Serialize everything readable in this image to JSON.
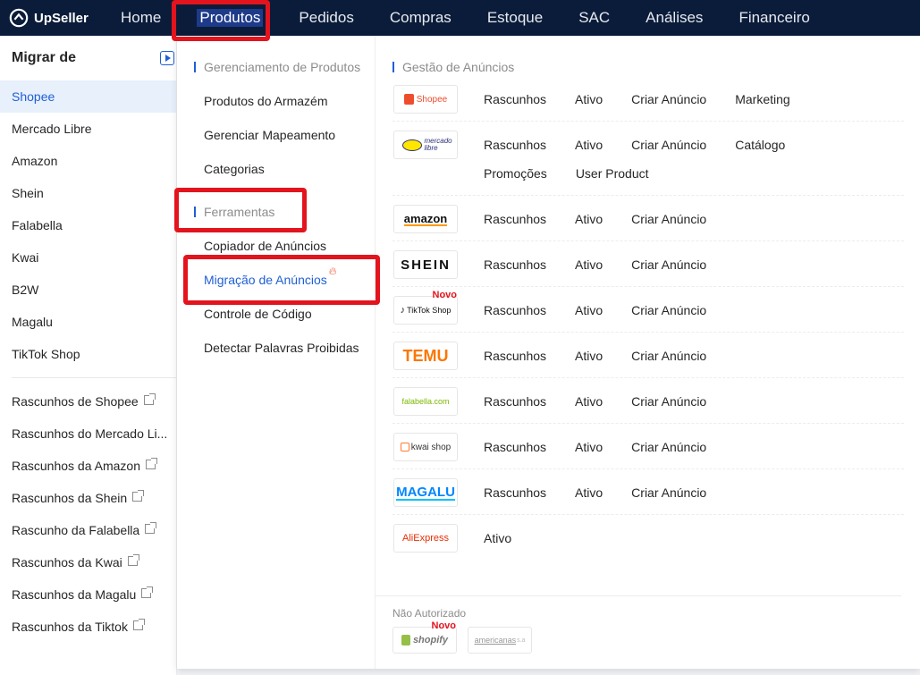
{
  "nav": {
    "brand": "UpSeller",
    "items": [
      "Home",
      "Produtos",
      "Pedidos",
      "Compras",
      "Estoque",
      "SAC",
      "Análises",
      "Financeiro"
    ]
  },
  "sidebar": {
    "title": "Migrar de",
    "platforms": [
      "Shopee",
      "Mercado Libre",
      "Amazon",
      "Shein",
      "Falabella",
      "Kwai",
      "B2W",
      "Magalu",
      "TikTok Shop"
    ],
    "drafts": [
      "Rascunhos de Shopee",
      "Rascunhos do Mercado Li...",
      "Rascunhos da Amazon",
      "Rascunhos da Shein",
      "Rascunho da Falabella",
      "Rascunhos da Kwai",
      "Rascunhos da Magalu",
      "Rascunhos da Tiktok"
    ]
  },
  "menu": {
    "section1": "Gerenciamento de Produtos",
    "section1_items": [
      "Produtos do Armazém",
      "Gerenciar Mapeamento",
      "Categorias"
    ],
    "section2": "Ferramentas",
    "section2_items": [
      "Copiador de Anúncios",
      "Migração de Anúncios",
      "Controle de Código",
      "Detectar Palavras Proibidas"
    ]
  },
  "listings": {
    "title": "Gestão de Anúncios",
    "rows": [
      {
        "logo": "Shopee",
        "links": [
          "Rascunhos",
          "Ativo",
          "Criar Anúncio",
          "Marketing"
        ]
      },
      {
        "logo": "mercado libre",
        "links": [
          "Rascunhos",
          "Ativo",
          "Criar Anúncio",
          "Catálogo",
          "Promoções",
          "User Product"
        ]
      },
      {
        "logo": "amazon",
        "links": [
          "Rascunhos",
          "Ativo",
          "Criar Anúncio"
        ]
      },
      {
        "logo": "SHEIN",
        "links": [
          "Rascunhos",
          "Ativo",
          "Criar Anúncio"
        ]
      },
      {
        "logo": "TikTok Shop",
        "badge": "Novo",
        "links": [
          "Rascunhos",
          "Ativo",
          "Criar Anúncio"
        ]
      },
      {
        "logo": "TEMU",
        "links": [
          "Rascunhos",
          "Ativo",
          "Criar Anúncio"
        ]
      },
      {
        "logo": "falabella.com",
        "links": [
          "Rascunhos",
          "Ativo",
          "Criar Anúncio"
        ]
      },
      {
        "logo": "kwai shop",
        "links": [
          "Rascunhos",
          "Ativo",
          "Criar Anúncio"
        ]
      },
      {
        "logo": "MAGALU",
        "links": [
          "Rascunhos",
          "Ativo",
          "Criar Anúncio"
        ]
      },
      {
        "logo": "AliExpress",
        "links": [
          "Ativo"
        ]
      }
    ],
    "unauthorized_label": "Não Autorizado",
    "unauthorized": [
      {
        "logo": "shopify",
        "badge": "Novo"
      },
      {
        "logo": "americanas",
        "suffix": "s.a"
      }
    ]
  },
  "colors": {
    "nav_bg": "#0b1c3a",
    "accent": "#1f5fd6",
    "highlight_red": "#e3141d"
  }
}
